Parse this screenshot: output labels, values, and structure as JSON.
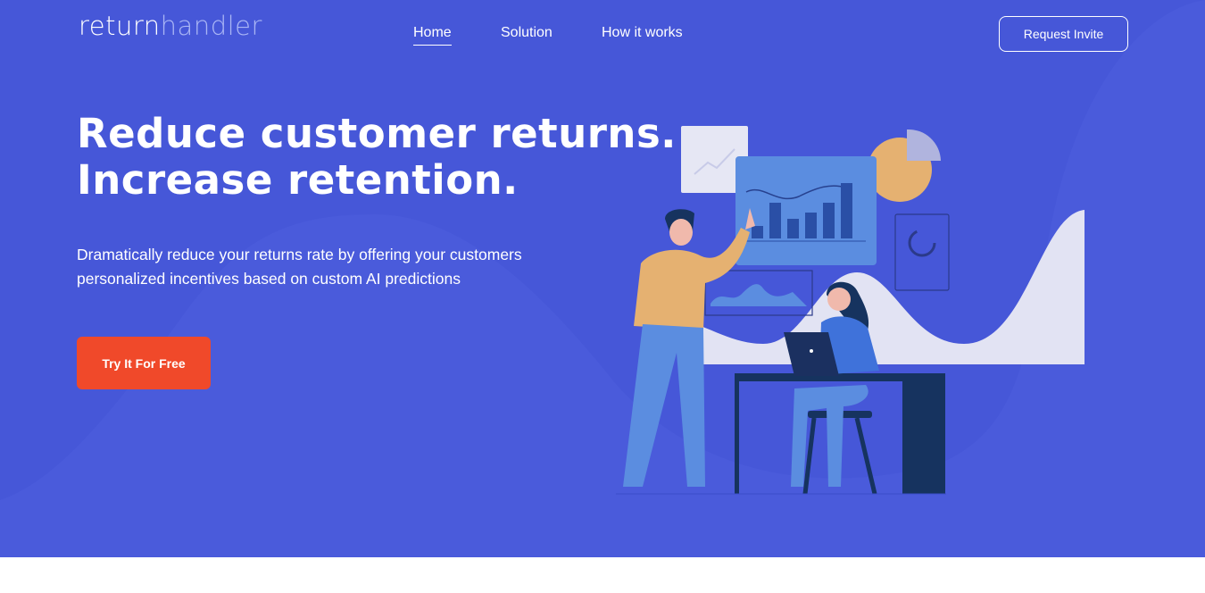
{
  "brand": {
    "logo_part1": "return",
    "logo_part2": "handler"
  },
  "nav": {
    "items": [
      {
        "label": "Home",
        "active": true
      },
      {
        "label": "Solution",
        "active": false
      },
      {
        "label": "How it works",
        "active": false
      }
    ],
    "cta_label": "Request Invite"
  },
  "hero": {
    "headline_line1": "Reduce customer returns.",
    "headline_line2": "Increase retention.",
    "subtext": "Dramatically reduce your returns rate by offering your customers personalized incentives based on custom AI predictions",
    "cta_label": "Try It For Free"
  },
  "colors": {
    "hero_bg": "#4657d8",
    "cta_bg": "#f0492a",
    "logo_accent": "#aab6f5"
  },
  "illustration": {
    "subject": "analytics-team-illustration"
  }
}
